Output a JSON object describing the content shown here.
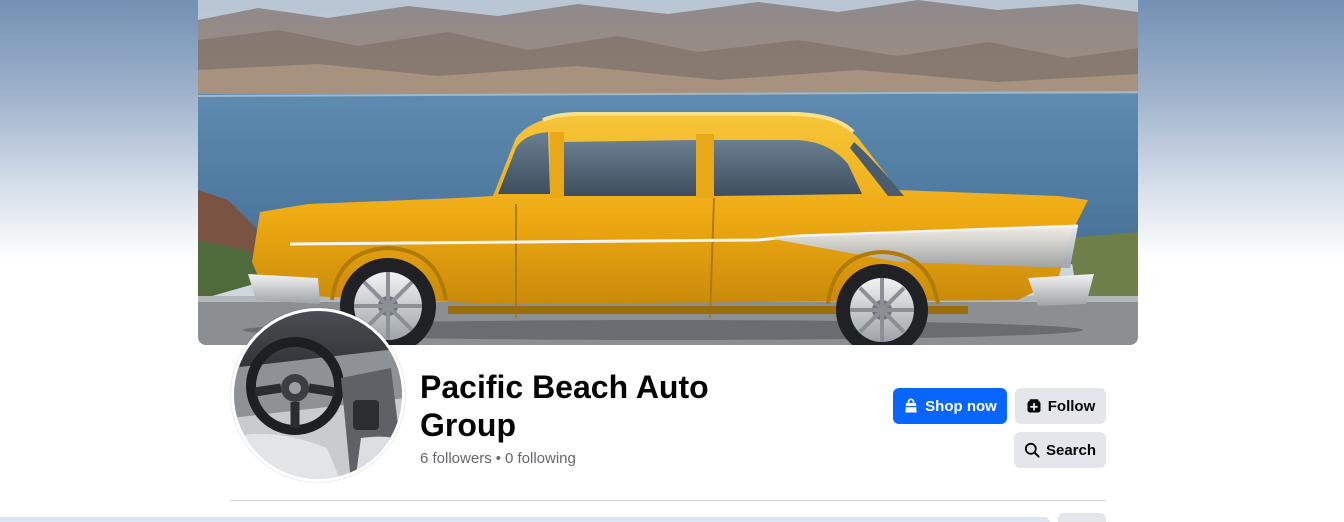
{
  "page": {
    "name": "Pacific Beach Auto Group",
    "followers": "6 followers",
    "separator": "•",
    "following": "0 following"
  },
  "actions": {
    "shop_label": "Shop now",
    "follow_label": "Follow",
    "search_label": "Search"
  },
  "icons": {
    "shop": "shopping-bag-icon",
    "follow": "follow-page-icon",
    "search": "search-icon"
  },
  "colors": {
    "primary_button": "#0866ff",
    "secondary_button": "#e4e6eb",
    "car_body": "#f0b21c",
    "lake": "#4f7ea3"
  }
}
